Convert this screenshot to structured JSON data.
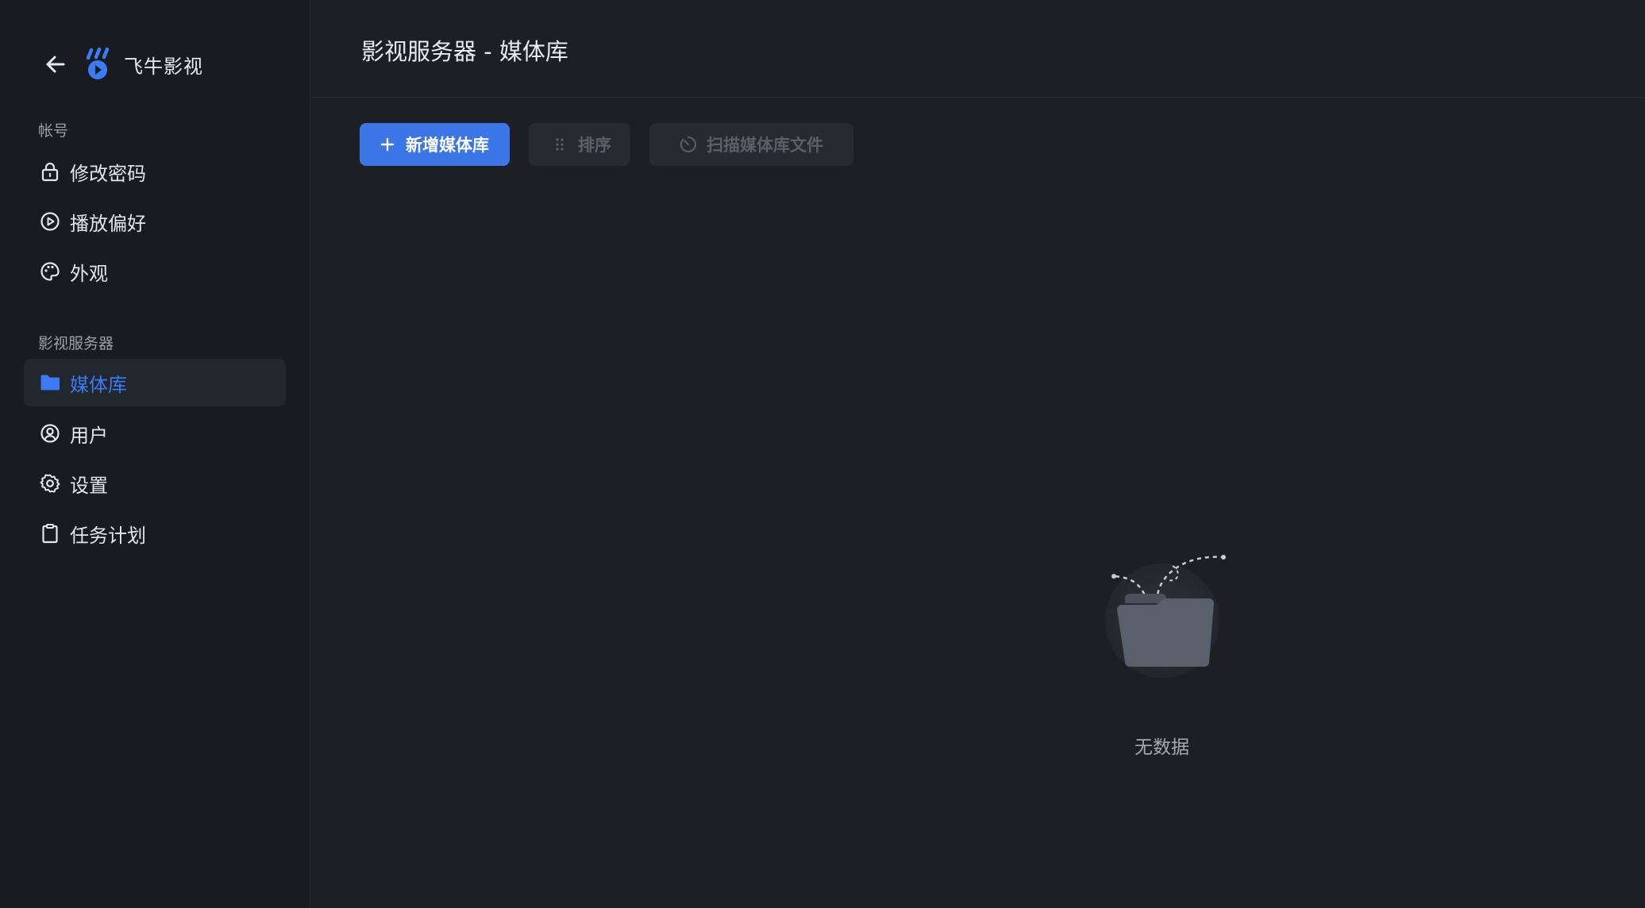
{
  "app": {
    "title": "飞牛影视"
  },
  "sidebar": {
    "sections": [
      {
        "label": "帐号",
        "items": [
          {
            "label": "修改密码",
            "icon": "lock-icon"
          },
          {
            "label": "播放偏好",
            "icon": "play-circle-icon"
          },
          {
            "label": "外观",
            "icon": "palette-icon"
          }
        ]
      },
      {
        "label": "影视服务器",
        "items": [
          {
            "label": "媒体库",
            "icon": "folder-icon",
            "active": true
          },
          {
            "label": "用户",
            "icon": "user-circle-icon"
          },
          {
            "label": "设置",
            "icon": "gear-icon"
          },
          {
            "label": "任务计划",
            "icon": "clipboard-icon"
          }
        ]
      }
    ]
  },
  "page": {
    "title": "影视服务器 - 媒体库"
  },
  "toolbar": {
    "add_label": "新增媒体库",
    "sort_label": "排序",
    "scan_label": "扫描媒体库文件"
  },
  "empty_state": {
    "text": "无数据"
  },
  "colors": {
    "accent": "#3b75e6",
    "active_text": "#3b7bf5",
    "background": "#1c1f24",
    "sidebar": "#181b20"
  }
}
